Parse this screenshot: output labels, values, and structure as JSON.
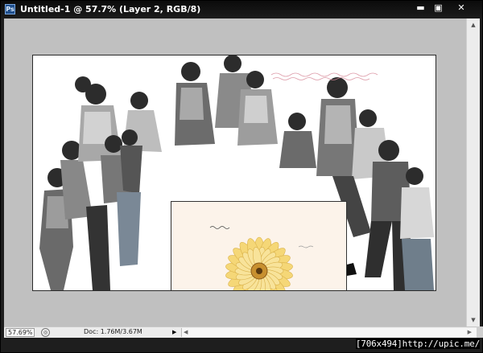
{
  "window": {
    "title": "Untitled-1 @ 57.7% (Layer 2, RGB/8)",
    "app_icon_text": "Ps",
    "minimize_glyph": "▬",
    "maximize_glyph": "▣",
    "close_glyph": "✕"
  },
  "status": {
    "zoom": "57.69%",
    "doc_info": "Doc: 1.76M/3.67M",
    "menu_glyph": "▶"
  },
  "scroll": {
    "up": "▲",
    "down": "▼",
    "left": "◀",
    "right": "▶"
  },
  "colors": {
    "canvas_bg": "#c0c0c0",
    "title_bar": "#111111",
    "flower_petal": "#f5d777",
    "flower_center": "#c8902f",
    "card_bg": "#fcf3ea"
  },
  "watermark": "[706x494]http://upic.me/"
}
